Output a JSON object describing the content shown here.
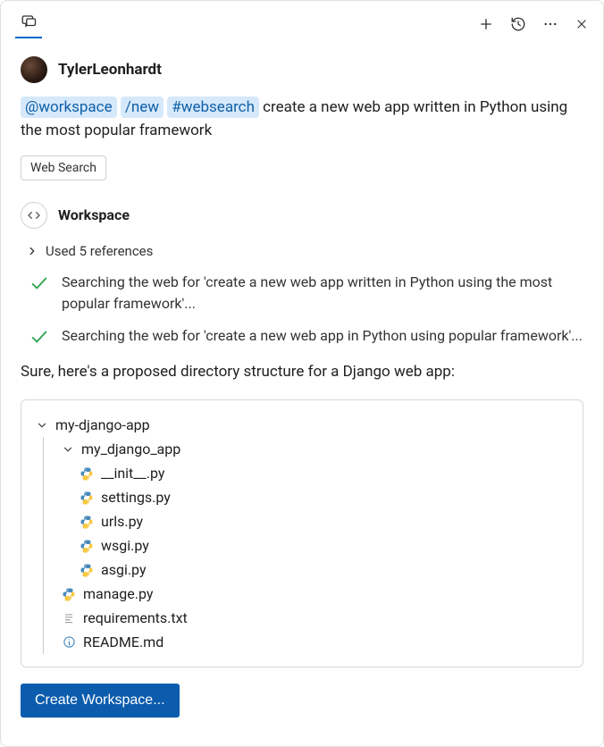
{
  "user": {
    "name": "TylerLeonhardt"
  },
  "query": {
    "chip_workspace": "@workspace",
    "chip_new": "/new",
    "chip_hash": "#websearch",
    "tail": " create a new web app written in Python using the most popular framework"
  },
  "tag_button": "Web Search",
  "agent": {
    "name": "Workspace"
  },
  "references_line": "Used 5 references",
  "steps": [
    "Searching the web for 'create a new web app written in Python using the most popular framework'...",
    "Searching the web for 'create a new web app in Python using popular framework'..."
  ],
  "response_intro": "Sure, here's a proposed directory structure for a Django web app:",
  "tree": {
    "root": "my-django-app",
    "pkg": "my_django_app",
    "files_pkg": [
      "__init__.py",
      "settings.py",
      "urls.py",
      "wsgi.py",
      "asgi.py"
    ],
    "files_root": [
      {
        "name": "manage.py",
        "icon": "python"
      },
      {
        "name": "requirements.txt",
        "icon": "text"
      },
      {
        "name": "README.md",
        "icon": "info"
      }
    ]
  },
  "create_button": "Create Workspace..."
}
